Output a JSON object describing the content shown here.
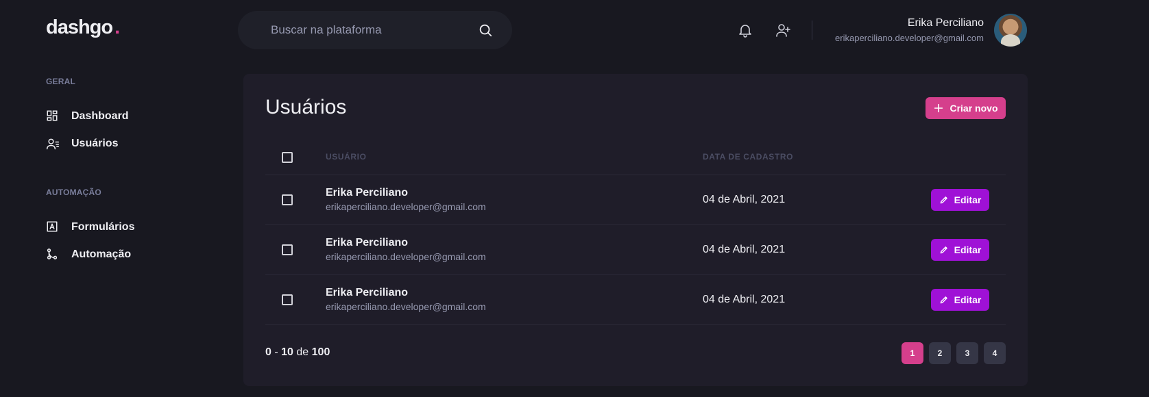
{
  "brand": {
    "name": "dashgo",
    "dot": "."
  },
  "search": {
    "placeholder": "Buscar na plataforma",
    "icon": "search-icon"
  },
  "header": {
    "icons": [
      "bell-icon",
      "user-add-icon"
    ],
    "profile": {
      "name": "Erika Perciliano",
      "email": "erikaperciliano.developer@gmail.com"
    }
  },
  "sidebar": {
    "sections": [
      {
        "title": "GERAL",
        "items": [
          {
            "label": "Dashboard",
            "icon": "dashboard-icon"
          },
          {
            "label": "Usuários",
            "icon": "users-icon"
          }
        ]
      },
      {
        "title": "AUTOMAÇÃO",
        "items": [
          {
            "label": "Formulários",
            "icon": "forms-icon"
          },
          {
            "label": "Automação",
            "icon": "git-merge-icon"
          }
        ]
      }
    ]
  },
  "main": {
    "title": "Usuários",
    "create_label": "Criar novo",
    "table": {
      "columns": [
        "USUÁRIO",
        "DATA DE CADASTRO"
      ],
      "rows": [
        {
          "name": "Erika Perciliano",
          "email": "erikaperciliano.developer@gmail.com",
          "date": "04 de Abril, 2021",
          "action": "Editar"
        },
        {
          "name": "Erika Perciliano",
          "email": "erikaperciliano.developer@gmail.com",
          "date": "04 de Abril, 2021",
          "action": "Editar"
        },
        {
          "name": "Erika Perciliano",
          "email": "erikaperciliano.developer@gmail.com",
          "date": "04 de Abril, 2021",
          "action": "Editar"
        }
      ]
    },
    "pagination": {
      "start": "0",
      "separator": "-",
      "end": "10",
      "of_label": "de",
      "total": "100",
      "pages": [
        "1",
        "2",
        "3",
        "4"
      ],
      "current": "1"
    }
  },
  "colors": {
    "accent": "#D53F8C",
    "edit": "#9F11D6",
    "background": "#181820",
    "panel": "#1F1D29"
  }
}
